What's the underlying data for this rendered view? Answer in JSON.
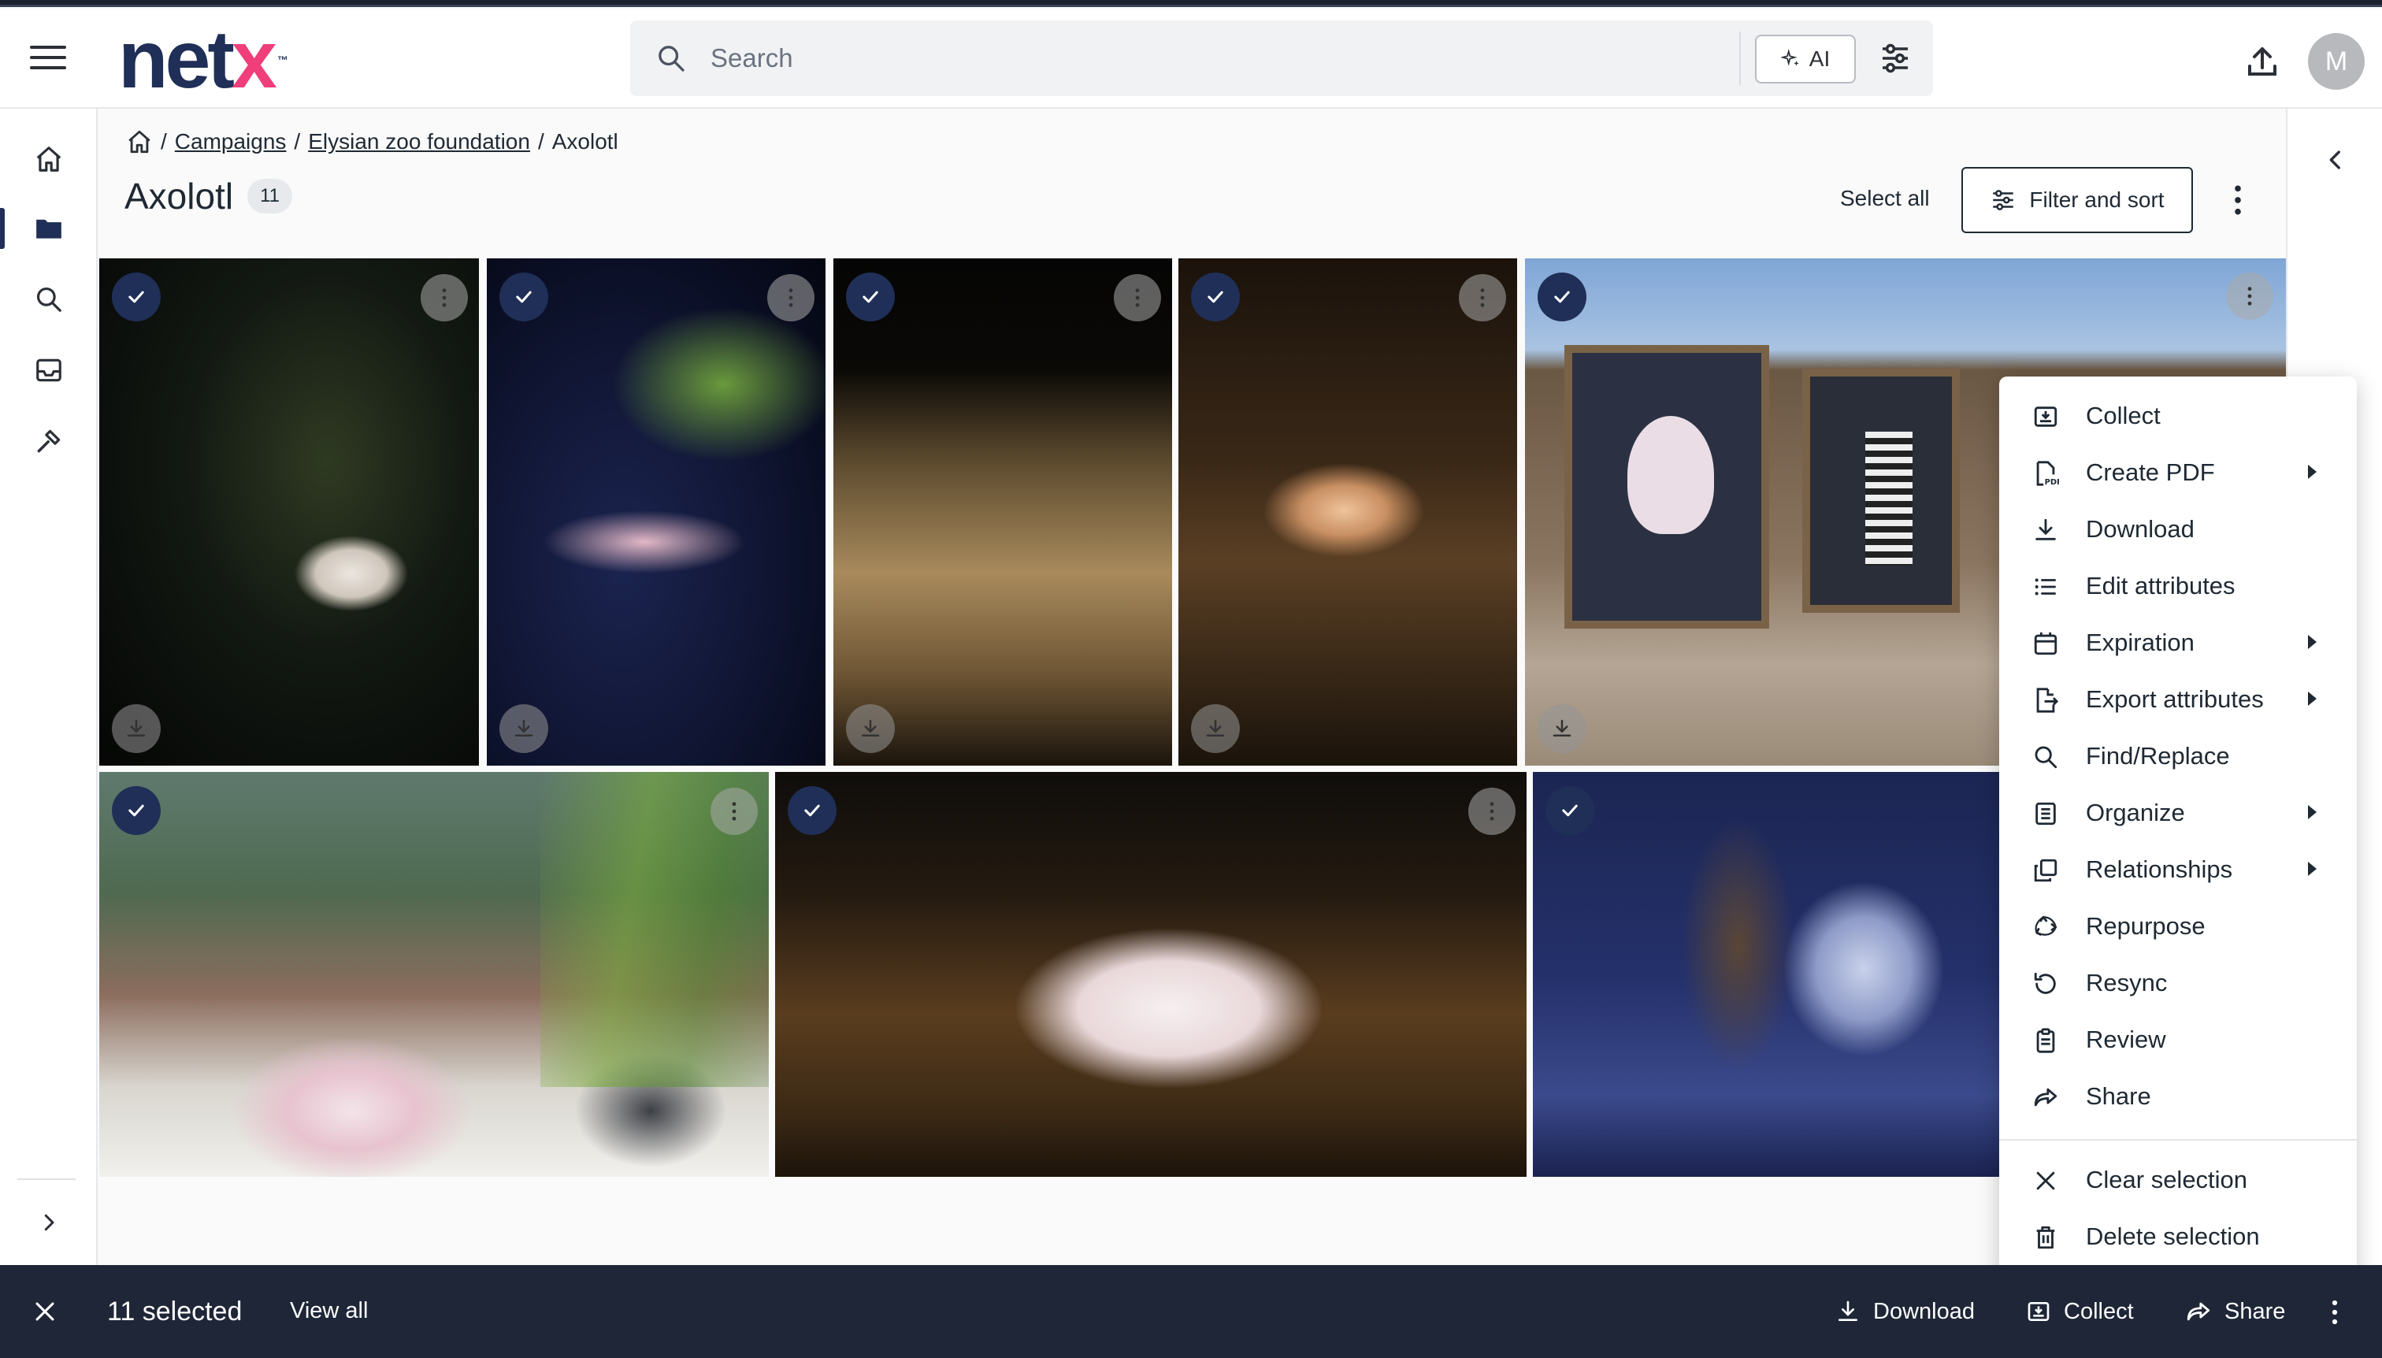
{
  "header": {
    "logo_main": "net",
    "logo_accent": "x",
    "logo_tm": "™",
    "search_placeholder": "Search",
    "ai_label": "AI",
    "avatar_initial": "M"
  },
  "breadcrumb": {
    "items": [
      "Campaigns",
      "Elysian zoo foundation"
    ],
    "current": "Axolotl",
    "separator": "/"
  },
  "page": {
    "title": "Axolotl",
    "count": "11",
    "select_all": "Select all",
    "filter_sort": "Filter and sort"
  },
  "context_menu": {
    "items": [
      {
        "label": "Collect",
        "icon": "collect-icon",
        "submenu": false
      },
      {
        "label": "Create PDF",
        "icon": "pdf-icon",
        "submenu": true
      },
      {
        "label": "Download",
        "icon": "download-icon",
        "submenu": false
      },
      {
        "label": "Edit attributes",
        "icon": "list-icon",
        "submenu": false
      },
      {
        "label": "Expiration",
        "icon": "calendar-icon",
        "submenu": true
      },
      {
        "label": "Export attributes",
        "icon": "export-icon",
        "submenu": true
      },
      {
        "label": "Find/Replace",
        "icon": "search-icon",
        "submenu": false
      },
      {
        "label": "Organize",
        "icon": "organize-icon",
        "submenu": true
      },
      {
        "label": "Relationships",
        "icon": "relationships-icon",
        "submenu": true
      },
      {
        "label": "Repurpose",
        "icon": "repurpose-icon",
        "submenu": false
      },
      {
        "label": "Resync",
        "icon": "resync-icon",
        "submenu": false
      },
      {
        "label": "Review",
        "icon": "review-icon",
        "submenu": false
      },
      {
        "label": "Share",
        "icon": "share-icon",
        "submenu": false
      }
    ],
    "footer_items": [
      {
        "label": "Clear selection",
        "icon": "close-icon"
      },
      {
        "label": "Delete selection",
        "icon": "trash-icon"
      }
    ]
  },
  "bottom_bar": {
    "selected": "11 selected",
    "view_all": "View all",
    "download": "Download",
    "collect": "Collect",
    "share": "Share"
  },
  "colors": {
    "brand_navy": "#1f2f57",
    "brand_pink": "#ef3e7a",
    "bottom_bar": "#1e2637"
  }
}
